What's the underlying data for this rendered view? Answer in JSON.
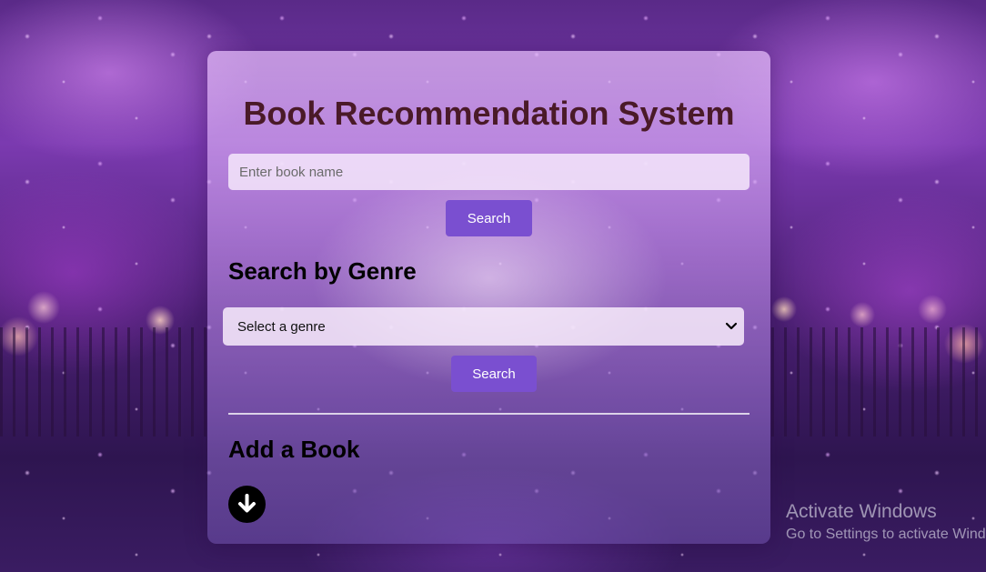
{
  "app": {
    "title": "Book Recommendation System"
  },
  "book_search": {
    "placeholder": "Enter book name",
    "value": "",
    "button_label": "Search"
  },
  "genre_search": {
    "heading": "Search by Genre",
    "selected_option": "Select a genre",
    "button_label": "Search"
  },
  "add_book": {
    "heading": "Add a Book",
    "toggle_icon": "arrow-down-circle-icon"
  },
  "os_watermark": {
    "line1": "Activate Windows",
    "line2": "Go to Settings to activate Windows."
  },
  "colors": {
    "accent_button": "#7a4fd0",
    "title_color": "#4a1a28"
  }
}
